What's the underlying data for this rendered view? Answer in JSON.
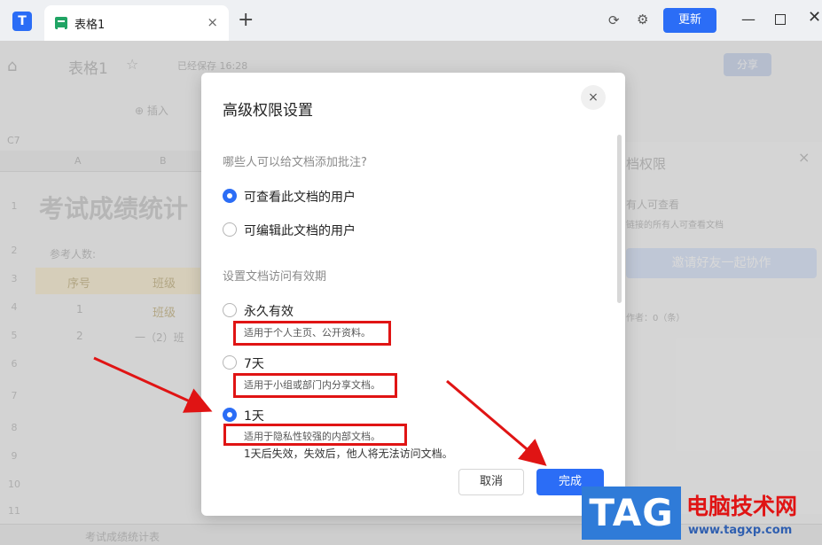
{
  "titlebar": {
    "logo_icon": "app-logo-icon",
    "tab_title": "表格1",
    "tab_close": "×",
    "new_tab": "+",
    "sync_icon": "⟳",
    "settings_icon": "⚙",
    "update_label": "更新",
    "minimize": "—",
    "close": "✕"
  },
  "background": {
    "home_icon": "⌂",
    "doc_title": "表格1",
    "star_icon": "☆",
    "saved_status": "已经保存 16:28",
    "share_label": "分享",
    "insert_label": "⊕ 插入",
    "cell_ref": "C7",
    "col_a": "A",
    "col_b": "B",
    "rows": [
      "1",
      "2",
      "3",
      "4",
      "5",
      "6",
      "7",
      "8",
      "9",
      "10",
      "11"
    ],
    "sheet_title": "考试成绩统计",
    "participant_label": "参考人数:",
    "header_seq": "序号",
    "header_class": "班级",
    "row1_seq": "1",
    "row1_class": "班级",
    "row2_seq": "2",
    "row2_class": "一（2）班",
    "side_panel": {
      "title": "档权限",
      "close": "×",
      "line1": "有人可查看",
      "line2": "链接的所有人可查看文档",
      "invite": "邀请好友一起协作",
      "line3": "作者：0（条）"
    },
    "sheet_tab": "考试成绩统计表"
  },
  "dialog": {
    "title": "高级权限设置",
    "close_icon": "×",
    "comment_question": "哪些人可以给文档添加批注?",
    "comment_options": [
      {
        "label": "可查看此文档的用户",
        "checked": true
      },
      {
        "label": "可编辑此文档的用户",
        "checked": false
      }
    ],
    "validity_question": "设置文档访问有效期",
    "validity_options": [
      {
        "label": "永久有效",
        "desc": "适用于个人主页、公开资料。",
        "checked": false
      },
      {
        "label": "7天",
        "desc": "适用于小组或部门内分享文档。",
        "checked": false
      },
      {
        "label": "1天",
        "desc": "适用于隐私性较强的内部文档。",
        "checked": true
      }
    ],
    "expiry_note": "1天后失效，失效后，他人将无法访问文档。",
    "cancel_label": "取消",
    "done_label": "完成"
  },
  "watermark": {
    "tag": "TAG",
    "site_name": "电脑技术网",
    "url": "www.tagxp.com"
  },
  "colors": {
    "accent": "#2b6df6",
    "annotation_red": "#e01414"
  }
}
